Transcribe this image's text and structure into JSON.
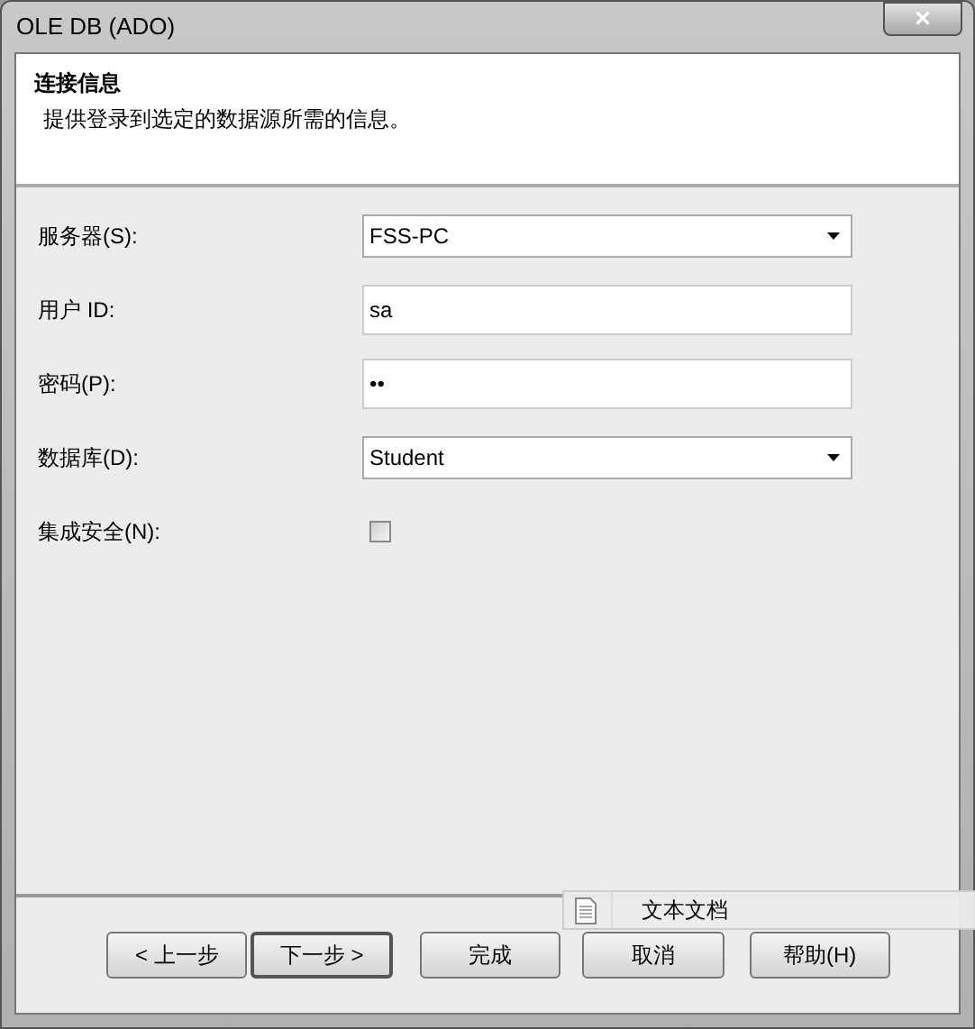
{
  "window": {
    "title": "OLE DB (ADO)",
    "close": "×"
  },
  "header": {
    "title": "连接信息",
    "description": "提供登录到选定的数据源所需的信息。"
  },
  "fields": [
    {
      "kind": "dropdown",
      "label": "服务器(S):",
      "value": "FSS-PC"
    },
    {
      "kind": "text",
      "label": "用户 ID:",
      "value": "sa"
    },
    {
      "kind": "password",
      "label": "密码(P):",
      "value": "••"
    },
    {
      "kind": "dropdown",
      "label": "数据库(D):",
      "value": "Student"
    },
    {
      "kind": "checkbox",
      "label": "集成安全(N):",
      "checked": false
    }
  ],
  "tooltip": {
    "text": "文本文档"
  },
  "buttons": [
    {
      "label": "< 上一步",
      "default": false
    },
    {
      "label": "下一步 >",
      "default": true
    },
    {
      "label": "完成",
      "default": false
    },
    {
      "label": "取消",
      "default": false
    },
    {
      "label": "帮助(H)",
      "default": false
    }
  ]
}
